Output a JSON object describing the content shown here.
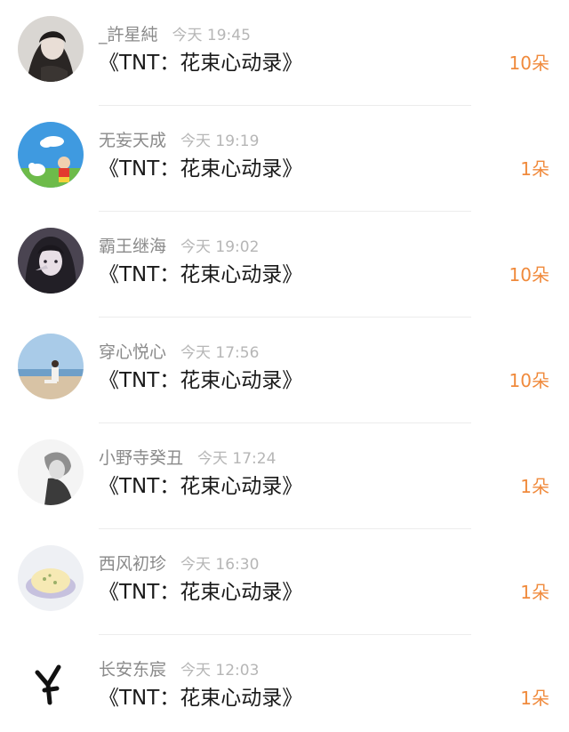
{
  "gifts": [
    {
      "user": "_許星純",
      "time": "今天 19:45",
      "item": "《TNT：花束心动录》",
      "amount": "10朵",
      "avatar": "avatar-girl-dark-hair"
    },
    {
      "user": "无妄天成",
      "time": "今天 19:19",
      "item": "《TNT：花束心动录》",
      "amount": "1朵",
      "avatar": "avatar-cartoon-sky"
    },
    {
      "user": "霸王继海",
      "time": "今天 19:02",
      "item": "《TNT：花束心动录》",
      "amount": "10朵",
      "avatar": "avatar-anime-girl"
    },
    {
      "user": "穿心悦心",
      "time": "今天 17:56",
      "item": "《TNT：花束心动录》",
      "amount": "10朵",
      "avatar": "avatar-beach-photo"
    },
    {
      "user": "小野寺癸丑",
      "time": "今天 17:24",
      "item": "《TNT：花束心动录》",
      "amount": "1朵",
      "avatar": "avatar-grey-sketch"
    },
    {
      "user": "西风初珍",
      "time": "今天 16:30",
      "item": "《TNT：花束心动录》",
      "amount": "1朵",
      "avatar": "avatar-food-bowl"
    },
    {
      "user": "长安东宸",
      "time": "今天 12:03",
      "item": "《TNT：花束心动录》",
      "amount": "1朵",
      "avatar": "avatar-calligraphy"
    }
  ],
  "colors": {
    "amount": "#f08a3c",
    "name": "#8a8a8a",
    "time": "#b6b6b6",
    "title": "#1a1a1a"
  }
}
